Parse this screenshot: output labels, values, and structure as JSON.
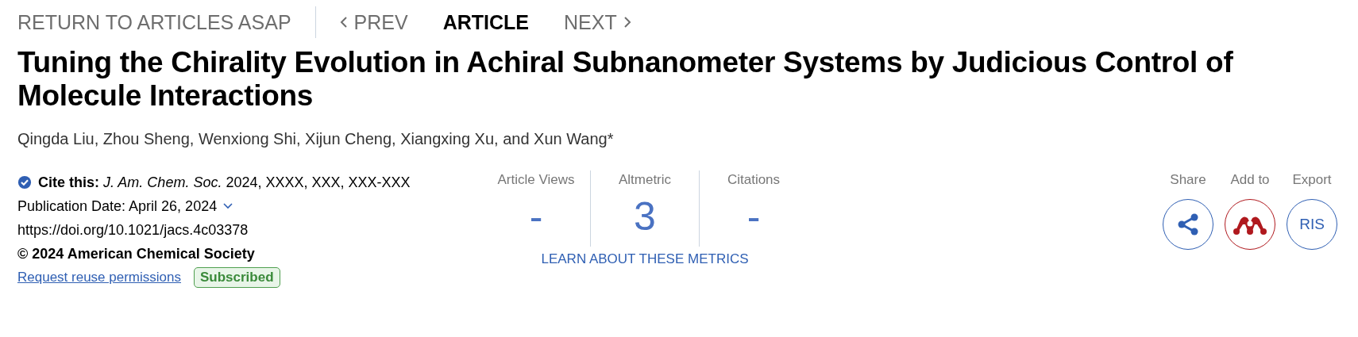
{
  "nav": {
    "return_link": "RETURN TO ARTICLES ASAP",
    "items": [
      {
        "kind": "prev",
        "label": "PREV",
        "selected": false
      },
      {
        "kind": "plain",
        "label": "ARTICLE",
        "selected": true
      },
      {
        "kind": "next",
        "label": "NEXT",
        "selected": false
      }
    ]
  },
  "title": "Tuning the Chirality Evolution in Achiral Subnanometer Systems by Judicious Control of Molecule Interactions",
  "authors": "Qingda Liu, Zhou Sheng, Wenxiong Shi, Xijun Cheng, Xiangxing Xu, and Xun Wang*",
  "citation": {
    "text": "**Cite this:** *J. Am. Chem. Soc.*  2024, XXXX, XXX, XXX-XXX",
    "publication_date": "Publication Date: April 26, 2024",
    "doi": "https://doi.org/10.1021/jacs.4c03378",
    "copyright": "© 2024 American Chemical Society",
    "reuse_link": "Request reuse permissions",
    "access_badge": "Subscribed"
  },
  "metrics": {
    "items": [
      {
        "label": "Article Views",
        "value": "-"
      },
      {
        "label": "Altmetric",
        "value": "3"
      },
      {
        "label": "Citations",
        "value": "-"
      }
    ],
    "learn_link": "LEARN ABOUT THESE METRICS"
  },
  "actions": [
    {
      "kind": "share",
      "label": "Share"
    },
    {
      "kind": "mendeley",
      "label": "Add to"
    },
    {
      "kind": "text",
      "label": "Export",
      "button_text": "RIS"
    }
  ]
}
